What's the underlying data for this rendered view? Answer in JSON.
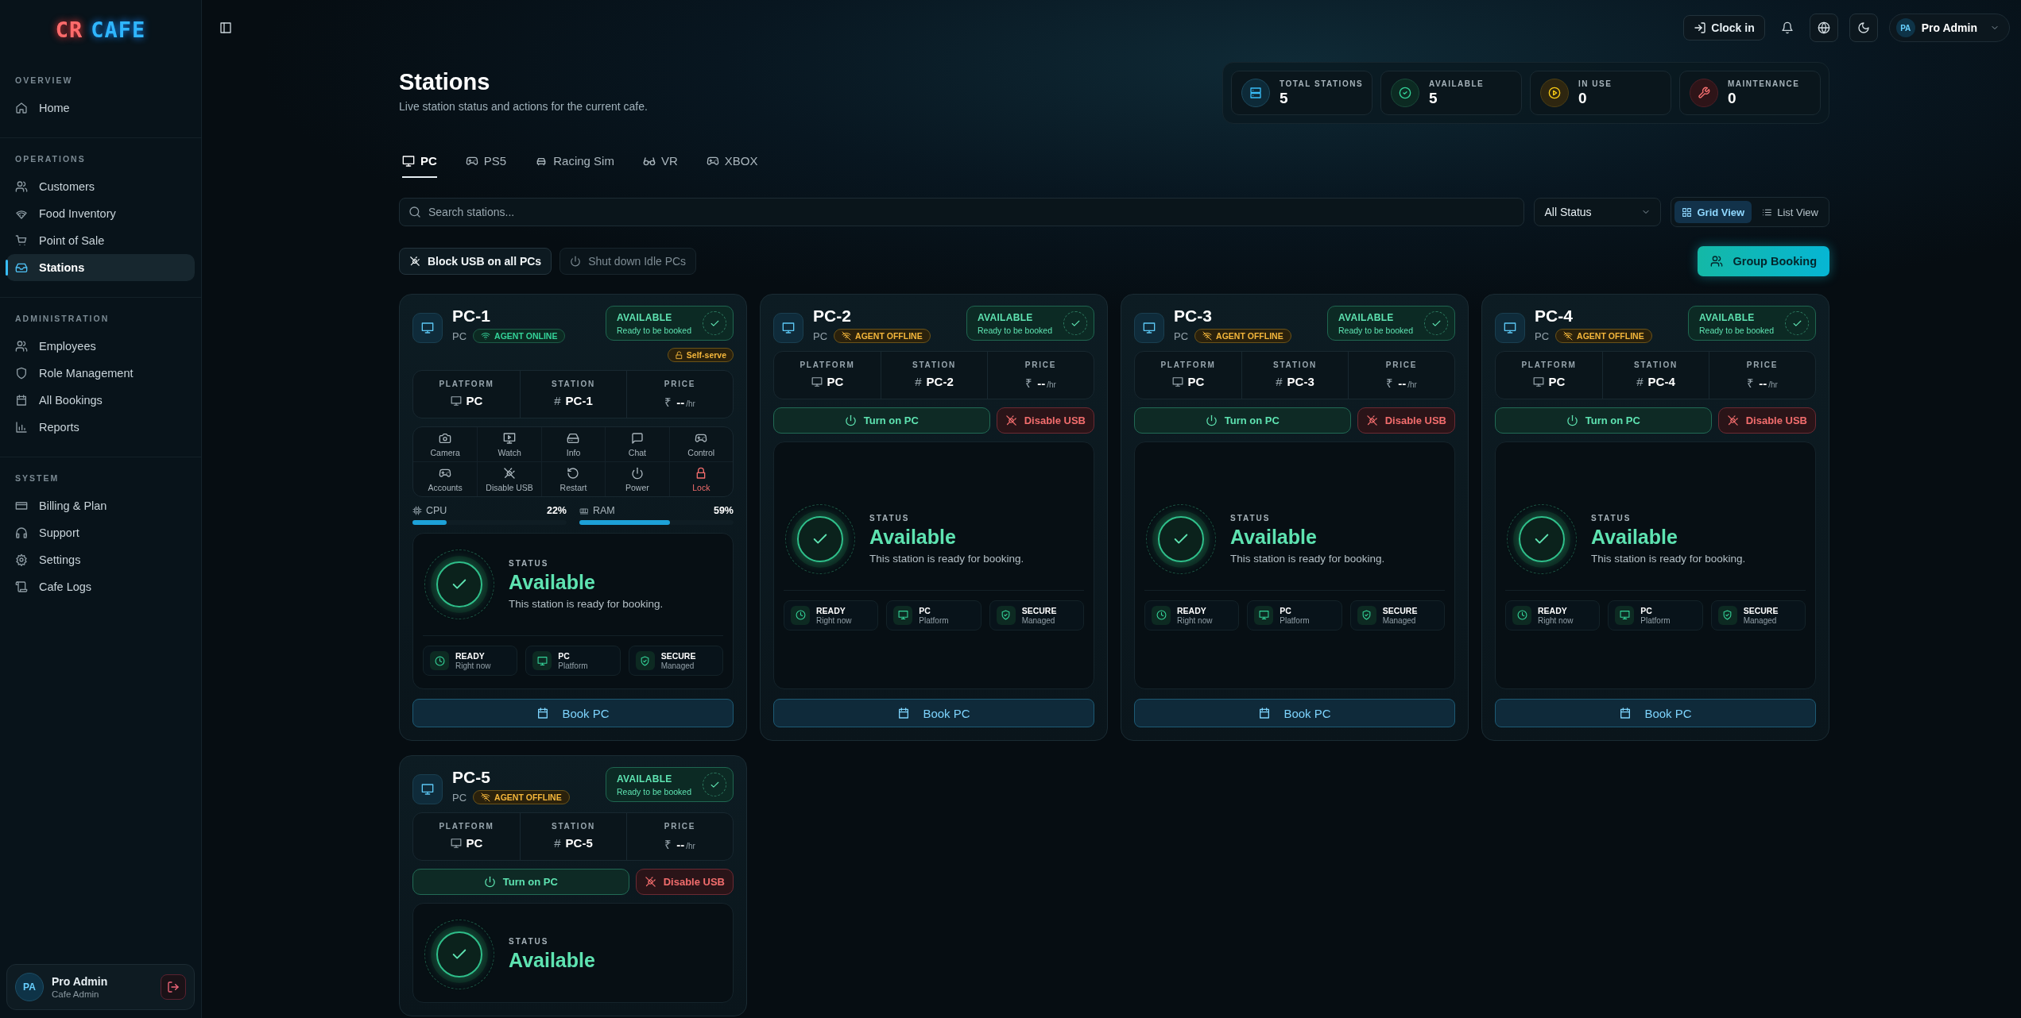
{
  "sidebar": {
    "logo": {
      "first": "CR",
      "second": "CAFE"
    },
    "sections": [
      {
        "heading": "OVERVIEW",
        "items": [
          {
            "label": "Home",
            "selected": false
          }
        ]
      },
      {
        "heading": "OPERATIONS",
        "items": [
          {
            "label": "Customers",
            "selected": false
          },
          {
            "label": "Food Inventory",
            "selected": false
          },
          {
            "label": "Point of Sale",
            "selected": false
          },
          {
            "label": "Stations",
            "selected": true
          }
        ]
      },
      {
        "heading": "ADMINISTRATION",
        "items": [
          {
            "label": "Employees",
            "selected": false
          },
          {
            "label": "Role Management",
            "selected": false
          },
          {
            "label": "All Bookings",
            "selected": false
          },
          {
            "label": "Reports",
            "selected": false
          }
        ]
      },
      {
        "heading": "SYSTEM",
        "items": [
          {
            "label": "Billing & Plan",
            "selected": false
          },
          {
            "label": "Support",
            "selected": false
          },
          {
            "label": "Settings",
            "selected": false
          },
          {
            "label": "Cafe Logs",
            "selected": false
          }
        ]
      }
    ],
    "user": {
      "initials": "PA",
      "name": "Pro Admin",
      "role": "Cafe Admin"
    }
  },
  "topbar": {
    "clock_in": "Clock in",
    "user": {
      "initials": "PA",
      "name": "Pro Admin"
    }
  },
  "page": {
    "title": "Stations",
    "subtitle": "Live station status and actions for the current cafe."
  },
  "stats": [
    {
      "kind": "total",
      "label": "TOTAL STATIONS",
      "value": "5"
    },
    {
      "kind": "available",
      "label": "AVAILABLE",
      "value": "5"
    },
    {
      "kind": "in_use",
      "label": "IN USE",
      "value": "0"
    },
    {
      "kind": "maintenance",
      "label": "MAINTENANCE",
      "value": "0"
    }
  ],
  "tabs": [
    {
      "label": "PC",
      "selected": true
    },
    {
      "label": "PS5",
      "selected": false
    },
    {
      "label": "Racing Sim",
      "selected": false
    },
    {
      "label": "VR",
      "selected": false
    },
    {
      "label": "XBOX",
      "selected": false
    }
  ],
  "search": {
    "placeholder": "Search stations..."
  },
  "status_filter": {
    "value": "All Status"
  },
  "views": [
    {
      "label": "Grid View",
      "selected": true
    },
    {
      "label": "List View",
      "selected": false
    }
  ],
  "bulk_actions": [
    {
      "label": "Block USB on all PCs",
      "disabled": false
    },
    {
      "label": "Shut down Idle PCs",
      "disabled": true
    }
  ],
  "group_booking": "Group Booking",
  "stations": [
    {
      "name": "PC-1",
      "platform": "PC",
      "kind": "available",
      "agent": {
        "online": true,
        "label": "AGENT ONLINE"
      },
      "badge": {
        "title": "AVAILABLE",
        "subtitle": "Ready to be booked"
      },
      "self_serve": "Self-serve",
      "specs": [
        {
          "label": "PLATFORM",
          "value": "PC"
        },
        {
          "label": "STATION",
          "prefix": "#",
          "value": "PC-1"
        },
        {
          "label": "PRICE",
          "prefix": "₹",
          "value": "--",
          "unit": "/hr"
        }
      ],
      "actions": [
        {
          "label": "Camera",
          "danger": false
        },
        {
          "label": "Watch",
          "danger": false
        },
        {
          "label": "Info",
          "danger": false
        },
        {
          "label": "Chat",
          "danger": false
        },
        {
          "label": "Control",
          "danger": false
        },
        {
          "label": "Accounts",
          "danger": false
        },
        {
          "label": "Disable USB",
          "danger": false
        },
        {
          "label": "Restart",
          "danger": false
        },
        {
          "label": "Power",
          "danger": false
        },
        {
          "label": "Lock",
          "danger": true
        }
      ],
      "metrics": [
        {
          "label": "CPU",
          "reading": "22%",
          "level": 0.22
        },
        {
          "label": "RAM",
          "reading": "59%",
          "level": 0.59
        }
      ],
      "status": {
        "label": "STATUS",
        "title": "Available",
        "description": "This station is ready for booking."
      },
      "chips": [
        {
          "title": "READY",
          "subtitle": "Right now"
        },
        {
          "title": "PC",
          "subtitle": "Platform"
        },
        {
          "title": "SECURE",
          "subtitle": "Managed"
        }
      ],
      "book": "Book PC"
    },
    {
      "name": "PC-2",
      "platform": "PC",
      "kind": "available",
      "agent": {
        "online": false,
        "label": "AGENT OFFLINE"
      },
      "badge": {
        "title": "AVAILABLE",
        "subtitle": "Ready to be booked"
      },
      "specs": [
        {
          "label": "PLATFORM",
          "value": "PC"
        },
        {
          "label": "STATION",
          "prefix": "#",
          "value": "PC-2"
        },
        {
          "label": "PRICE",
          "prefix": "₹",
          "value": "--",
          "unit": "/hr"
        }
      ],
      "controls": [
        {
          "kind": "power",
          "label": "Turn on PC"
        },
        {
          "kind": "usb",
          "label": "Disable USB"
        }
      ],
      "status": {
        "label": "STATUS",
        "title": "Available",
        "description": "This station is ready for booking."
      },
      "chips": [
        {
          "title": "READY",
          "subtitle": "Right now"
        },
        {
          "title": "PC",
          "subtitle": "Platform"
        },
        {
          "title": "SECURE",
          "subtitle": "Managed"
        }
      ],
      "book": "Book PC"
    },
    {
      "name": "PC-3",
      "platform": "PC",
      "kind": "available",
      "agent": {
        "online": false,
        "label": "AGENT OFFLINE"
      },
      "badge": {
        "title": "AVAILABLE",
        "subtitle": "Ready to be booked"
      },
      "specs": [
        {
          "label": "PLATFORM",
          "value": "PC"
        },
        {
          "label": "STATION",
          "prefix": "#",
          "value": "PC-3"
        },
        {
          "label": "PRICE",
          "prefix": "₹",
          "value": "--",
          "unit": "/hr"
        }
      ],
      "controls": [
        {
          "kind": "power",
          "label": "Turn on PC"
        },
        {
          "kind": "usb",
          "label": "Disable USB"
        }
      ],
      "status": {
        "label": "STATUS",
        "title": "Available",
        "description": "This station is ready for booking."
      },
      "chips": [
        {
          "title": "READY",
          "subtitle": "Right now"
        },
        {
          "title": "PC",
          "subtitle": "Platform"
        },
        {
          "title": "SECURE",
          "subtitle": "Managed"
        }
      ],
      "book": "Book PC"
    },
    {
      "name": "PC-4",
      "platform": "PC",
      "kind": "available",
      "agent": {
        "online": false,
        "label": "AGENT OFFLINE"
      },
      "badge": {
        "title": "AVAILABLE",
        "subtitle": "Ready to be booked"
      },
      "specs": [
        {
          "label": "PLATFORM",
          "value": "PC"
        },
        {
          "label": "STATION",
          "prefix": "#",
          "value": "PC-4"
        },
        {
          "label": "PRICE",
          "prefix": "₹",
          "value": "--",
          "unit": "/hr"
        }
      ],
      "controls": [
        {
          "kind": "power",
          "label": "Turn on PC"
        },
        {
          "kind": "usb",
          "label": "Disable USB"
        }
      ],
      "status": {
        "label": "STATUS",
        "title": "Available",
        "description": "This station is ready for booking."
      },
      "chips": [
        {
          "title": "READY",
          "subtitle": "Right now"
        },
        {
          "title": "PC",
          "subtitle": "Platform"
        },
        {
          "title": "SECURE",
          "subtitle": "Managed"
        }
      ],
      "book": "Book PC"
    },
    {
      "name": "PC-5",
      "platform": "PC",
      "kind": "available",
      "agent": {
        "online": false,
        "label": "AGENT OFFLINE"
      },
      "badge": {
        "title": "AVAILABLE",
        "subtitle": "Ready to be booked"
      },
      "specs": [
        {
          "label": "PLATFORM",
          "value": "PC"
        },
        {
          "label": "STATION",
          "prefix": "#",
          "value": "PC-5"
        },
        {
          "label": "PRICE",
          "prefix": "₹",
          "value": "--",
          "unit": "/hr"
        }
      ],
      "controls": [
        {
          "kind": "power",
          "label": "Turn on PC"
        },
        {
          "kind": "usb",
          "label": "Disable USB"
        }
      ],
      "status": {
        "label": "STATUS",
        "title": "Available"
      }
    }
  ]
}
